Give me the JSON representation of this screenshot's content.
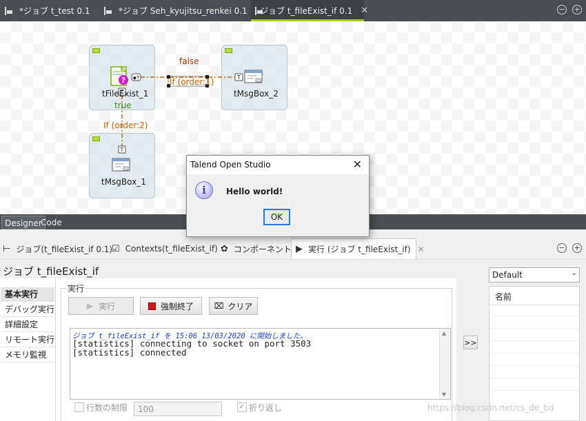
{
  "editor_tabs": [
    {
      "label": "*ジョブ t_test 0.1",
      "icon": "job-icon",
      "active": false
    },
    {
      "label": "*ジョブ Seh_kyujitsu_renkei 0.1",
      "icon": "job-icon",
      "active": false
    },
    {
      "label": "ジョブ t_fileExist_if 0.1",
      "icon": "job-icon",
      "active": true
    }
  ],
  "canvas": {
    "components": [
      {
        "name": "tFileExist_1",
        "icon": "file-exist-icon"
      },
      {
        "name": "tMsgBox_2",
        "icon": "msgbox-icon"
      },
      {
        "name": "tMsgBox_1",
        "icon": "msgbox-icon"
      }
    ],
    "links": {
      "false_label": "false",
      "true_label": "true",
      "if1_label": "If (order:1)",
      "if2_label": "If (order:2)"
    }
  },
  "designer_tabs": [
    "Designer",
    "Code"
  ],
  "lower_tabs": [
    {
      "label": "ジョブ(t_fileExist_if 0.1)",
      "icon": "job-icon"
    },
    {
      "label": "Contexts(t_fileExist_if)",
      "icon": "contexts-icon"
    },
    {
      "label": "コンポーネント",
      "icon": "component-icon"
    },
    {
      "label": "実行 (ジョブ t_fileExist_if)",
      "icon": "run-icon",
      "active": true
    }
  ],
  "job_panel": {
    "title": "ジョブ t_fileExist_if",
    "side_tabs": [
      "基本実行",
      "デバッグ実行",
      "詳細設定",
      "リモート実行",
      "メモリ監視"
    ],
    "group_label": "実行",
    "run_button": "実行",
    "kill_button": "強制終了",
    "clear_button": "クリア",
    "console_lines": [
      "ジョブ t_fileExist_if を 15:06 13/03/2020 に開始しました。",
      "[statistics] connecting to socket on port 3503",
      "[statistics] connected"
    ],
    "limit_label": "行数の制限",
    "limit_value": "100",
    "wrap_label": "折り返し",
    "move_button": ">>"
  },
  "context_panel": {
    "selected": "Default",
    "column_header": "名前"
  },
  "dialog": {
    "title": "Talend Open Studio",
    "message": "Hello world!",
    "ok_label": "OK"
  },
  "watermark": "https://blog.csdn.net/cs_de_bd",
  "colors": {
    "link_orange": "#c86400",
    "link_green": "#3a8a1a",
    "false_red": "#b03000",
    "active_tab_accent": "#a8cc1c",
    "dark_chrome": "#4a4d52"
  }
}
